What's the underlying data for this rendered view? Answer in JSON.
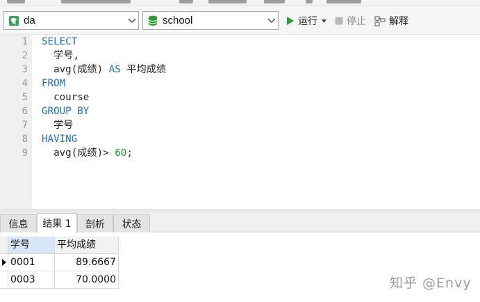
{
  "toolbar": {
    "connection": {
      "value": "da",
      "icon": "connection-icon"
    },
    "database": {
      "value": "school",
      "icon": "database-icon"
    },
    "run_label": "运行",
    "stop_label": "停止",
    "explain_label": "解释",
    "colors": {
      "run": "#21a336",
      "db": "#2ca02c"
    }
  },
  "editor": {
    "line_numbers": [
      "1",
      "2",
      "3",
      "4",
      "5",
      "6",
      "7",
      "8",
      "9"
    ],
    "lines": [
      [
        {
          "t": "SELECT",
          "c": "kw"
        }
      ],
      [
        {
          "t": "  学号,",
          "c": ""
        }
      ],
      [
        {
          "t": "  avg(成绩) ",
          "c": ""
        },
        {
          "t": "AS",
          "c": "kw"
        },
        {
          "t": " 平均成绩",
          "c": ""
        }
      ],
      [
        {
          "t": "FROM",
          "c": "kw"
        }
      ],
      [
        {
          "t": "  course",
          "c": ""
        }
      ],
      [
        {
          "t": "GROUP BY",
          "c": "kw"
        }
      ],
      [
        {
          "t": "  学号",
          "c": ""
        }
      ],
      [
        {
          "t": "HAVING",
          "c": "kw"
        }
      ],
      [
        {
          "t": "  avg(成绩)> ",
          "c": ""
        },
        {
          "t": "60",
          "c": "num"
        },
        {
          "t": ";",
          "c": ""
        }
      ]
    ],
    "colors": {
      "keyword": "#1a6fd6",
      "number": "#1e9e3a"
    }
  },
  "tabs": [
    {
      "label": "信息",
      "active": false
    },
    {
      "label": "结果 1",
      "active": true
    },
    {
      "label": "剖析",
      "active": false
    },
    {
      "label": "状态",
      "active": false
    }
  ],
  "result": {
    "columns": [
      "学号",
      "平均成绩"
    ],
    "rows": [
      [
        "0001",
        "89.6667"
      ],
      [
        "0003",
        "70.0000"
      ]
    ]
  },
  "watermark": "知乎 @Envy"
}
